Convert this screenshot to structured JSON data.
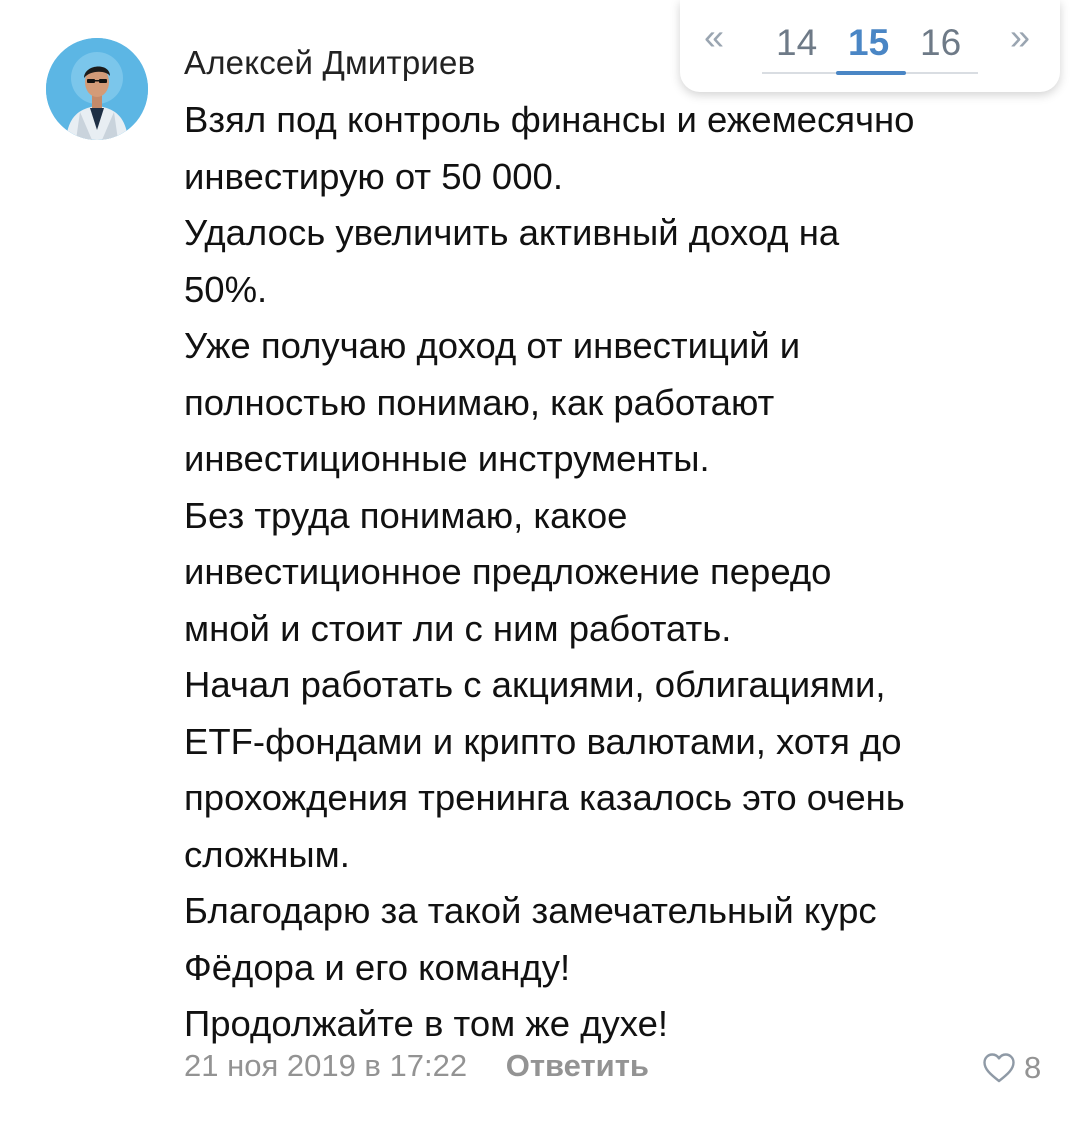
{
  "comment": {
    "author": "Алексей Дмитриев",
    "avatar_icon": "user-photo-avatar",
    "lines": [
      "Взял под контроль финансы и ежемесячно",
      "инвестирую от 50 000.",
      "Удалось увеличить активный доход на",
      "50%.",
      "Уже получаю доход от инвестиций и",
      "полностью понимаю, как работают",
      "инвестиционные инструменты.",
      "Без труда понимаю, какое",
      "инвестиционное предложение передо",
      "мной и стоит ли с ним работать.",
      "Начал работать с акциями, облигациями,",
      "ETF-фондами и крипто валютами, хотя до",
      "прохождения тренинга казалось это очень",
      "сложным.",
      "Благодарю за такой замечательный курс",
      "Фёдора и его команду!",
      "Продолжайте в том же духе!"
    ],
    "date": "21 ноя 2019 в 17:22",
    "reply_label": "Ответить",
    "like_icon": "heart-outline-icon",
    "likes": "8"
  },
  "pager": {
    "prev": "«",
    "next": "»",
    "pages": [
      "14",
      "15",
      "16"
    ],
    "current": "15",
    "accent_color": "#4a86c5"
  }
}
